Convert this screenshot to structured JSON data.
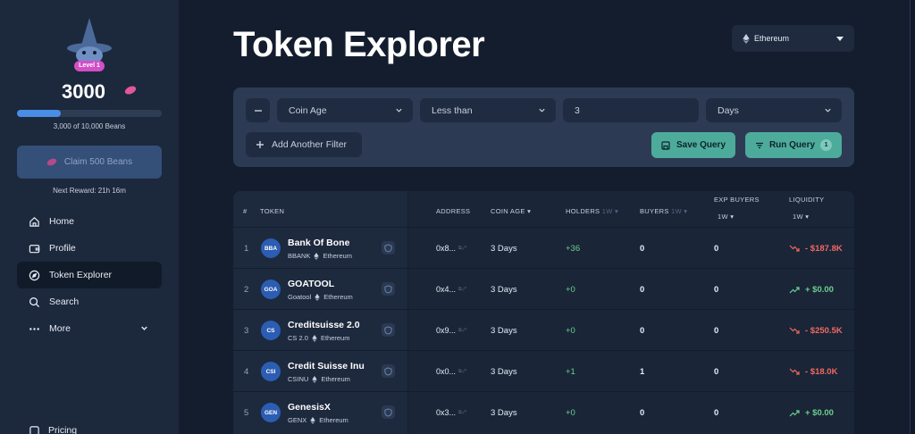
{
  "sidebar": {
    "level_badge": "Level 1",
    "beans_count": "3000",
    "progress_fraction": 0.3,
    "progress_text": "3,000 of 10,000 Beans",
    "claim_label": "Claim 500 Beans",
    "next_reward": "Next Reward: 21h 16m",
    "nav": [
      {
        "label": "Home",
        "icon": "home-icon"
      },
      {
        "label": "Profile",
        "icon": "wallet-icon"
      },
      {
        "label": "Token Explorer",
        "icon": "compass-icon",
        "active": true
      },
      {
        "label": "Search",
        "icon": "search-icon"
      },
      {
        "label": "More",
        "icon": "dots-icon"
      }
    ],
    "pricing_label": "Pricing"
  },
  "header": {
    "title": "Token Explorer",
    "network": "Ethereum"
  },
  "filters": {
    "field": "Coin Age",
    "operator": "Less than",
    "value": "3",
    "unit": "Days",
    "add_filter": "Add Another Filter",
    "save_query": "Save Query",
    "run_query": "Run Query",
    "run_count": "1"
  },
  "table": {
    "columns": {
      "num": "#",
      "token": "TOKEN",
      "address": "ADDRESS",
      "coin_age": "COIN AGE",
      "holders": "HOLDERS",
      "buyers": "BUYERS",
      "exp_buyers": "EXP BUYERS",
      "liquidity": "LIQUIDITY",
      "period": "1W"
    },
    "rows": [
      {
        "num": "1",
        "badge": "BBA",
        "name": "Bank Of Bone",
        "symbol": "BBANK",
        "chain": "Ethereum",
        "address": "0x8...",
        "age": "3 Days",
        "holders": "+36",
        "buyers": "0",
        "exp_buyers": "0",
        "liquidity": "- $187.8K",
        "trend": "down"
      },
      {
        "num": "2",
        "badge": "GOA",
        "name": "GOATOOL",
        "symbol": "Goatool",
        "chain": "Ethereum",
        "address": "0x4...",
        "age": "3 Days",
        "holders": "+0",
        "buyers": "0",
        "exp_buyers": "0",
        "liquidity": "+ $0.00",
        "trend": "up"
      },
      {
        "num": "3",
        "badge": "CS",
        "name": "Creditsuisse 2.0",
        "symbol": "CS 2.0",
        "chain": "Ethereum",
        "address": "0x9...",
        "age": "3 Days",
        "holders": "+0",
        "buyers": "0",
        "exp_buyers": "0",
        "liquidity": "- $250.5K",
        "trend": "down"
      },
      {
        "num": "4",
        "badge": "CSI",
        "name": "Credit Suisse Inu",
        "symbol": "CSINU",
        "chain": "Ethereum",
        "address": "0x0...",
        "age": "3 Days",
        "holders": "+1",
        "buyers": "1",
        "exp_buyers": "0",
        "liquidity": "- $18.0K",
        "trend": "down"
      },
      {
        "num": "5",
        "badge": "GEN",
        "name": "GenesisX",
        "symbol": "GENX",
        "chain": "Ethereum",
        "address": "0x3...",
        "age": "3 Days",
        "holders": "+0",
        "buyers": "0",
        "exp_buyers": "0",
        "liquidity": "+ $0.00",
        "trend": "up"
      }
    ]
  },
  "colors": {
    "accent": "#4dab9b",
    "positive": "#6bd08f",
    "negative": "#f0695f",
    "level": "#d24fc6"
  }
}
